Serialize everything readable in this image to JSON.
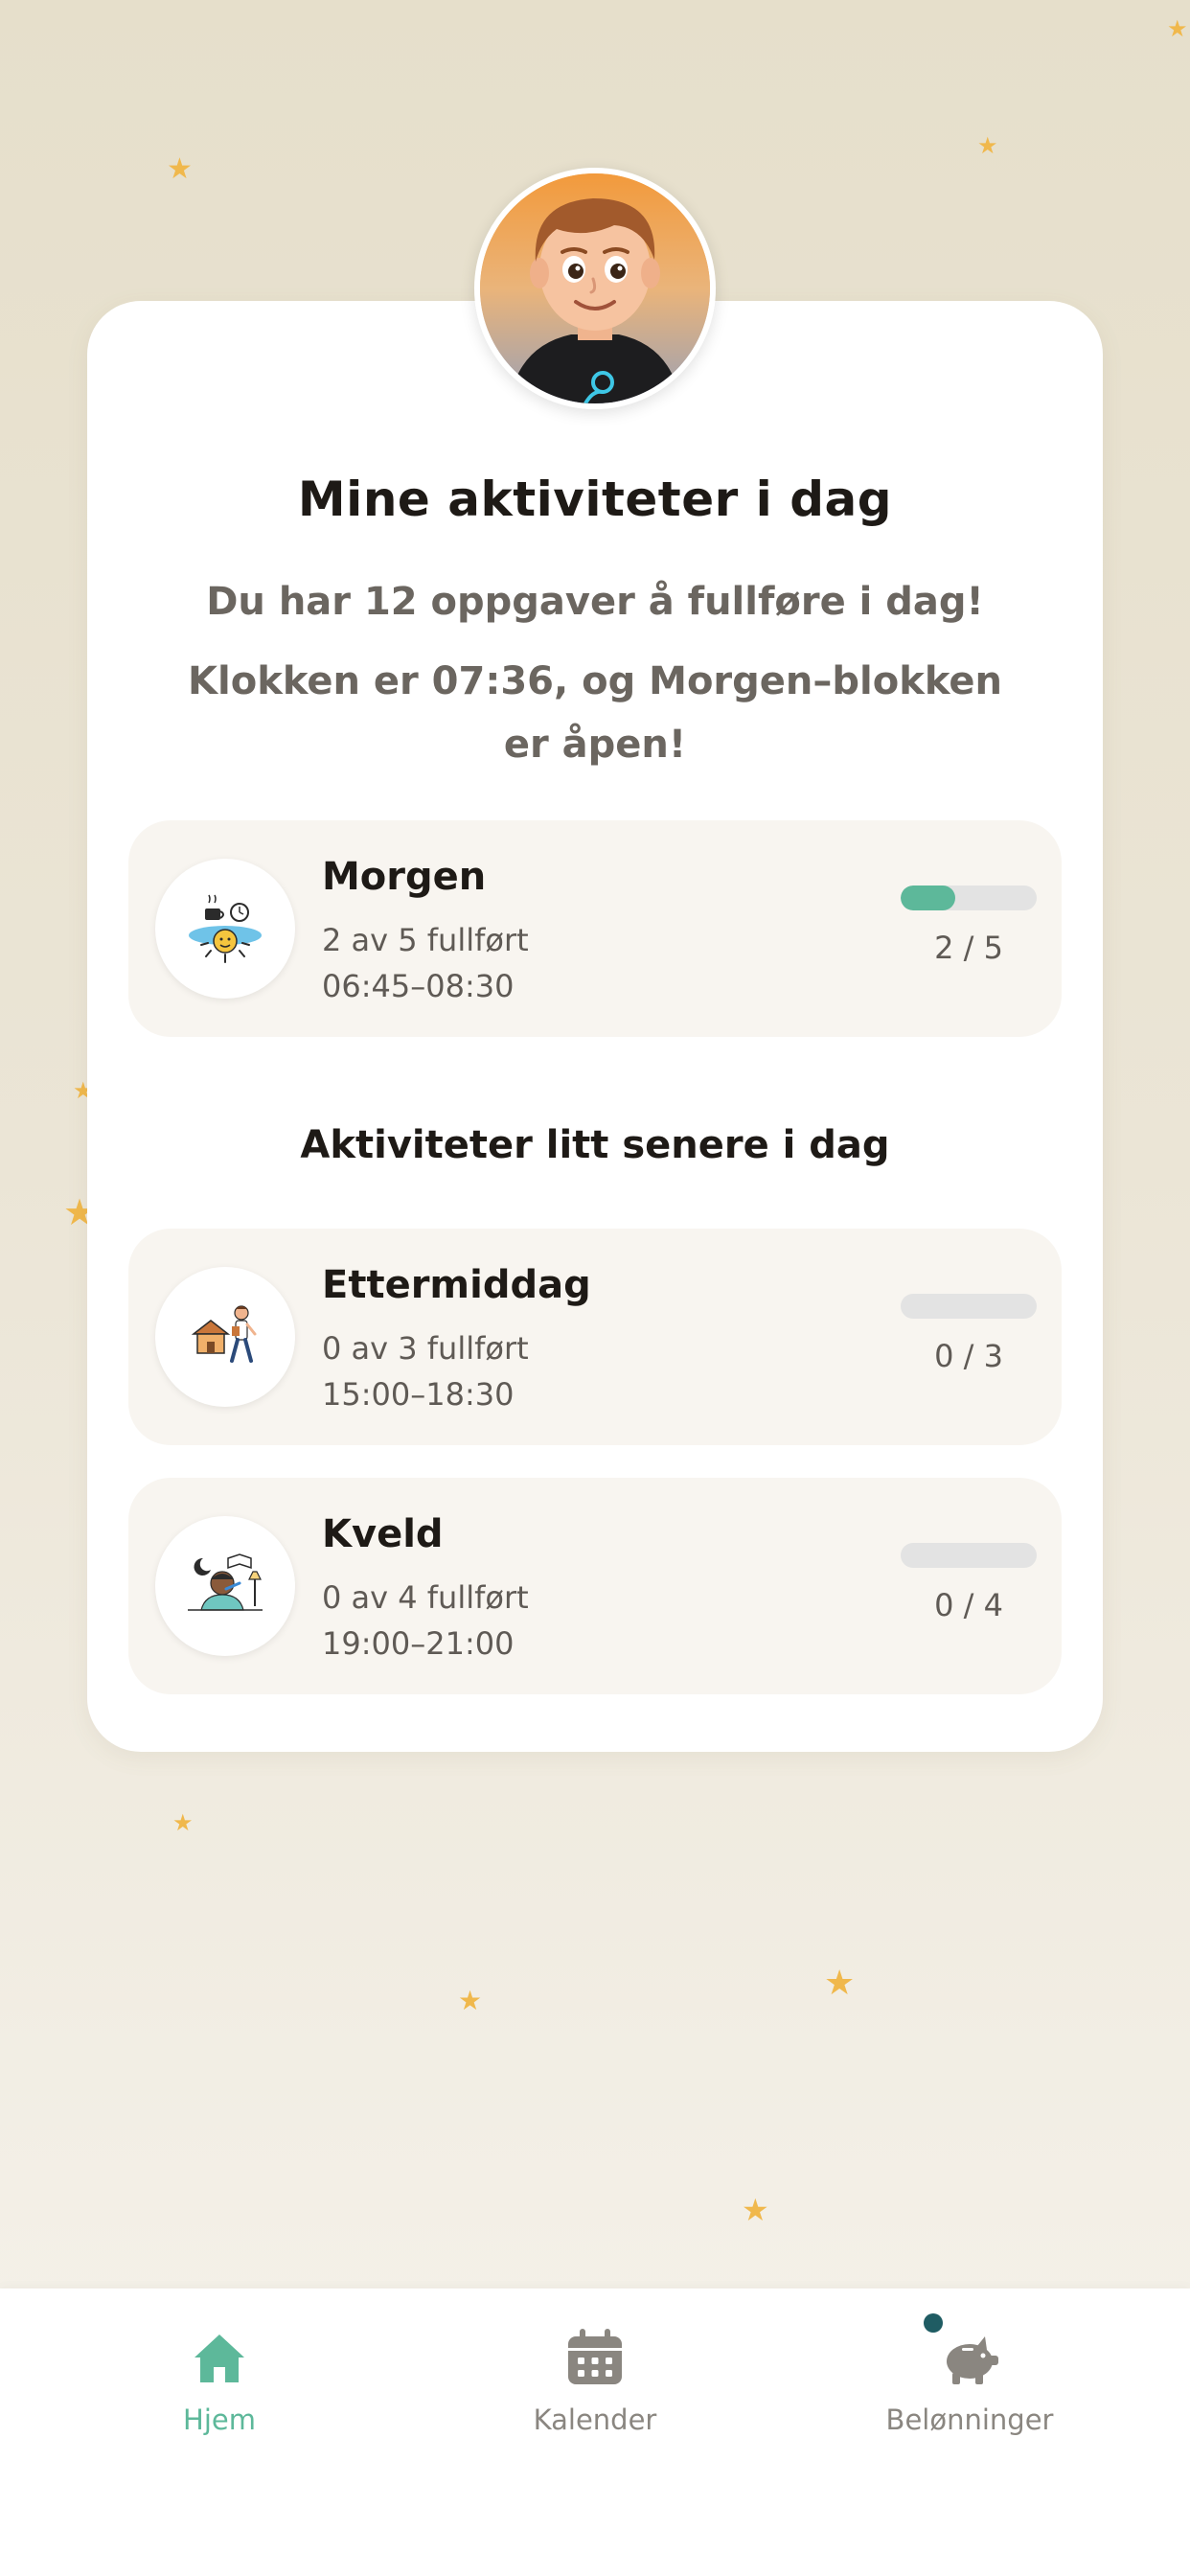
{
  "colors": {
    "accent": "#5db89a",
    "star": "#f0b84c",
    "muted_text": "#6b6660",
    "nav_inactive": "#8a8680",
    "badge": "#1f5c63"
  },
  "profile": {
    "avatar_icon": "child-avatar"
  },
  "page": {
    "title": "Mine aktiviteter i dag",
    "subtitle": "Du har 12 oppgaver å fullføre i dag!",
    "status": "Klokken er 07:36, og Morgen–blokken er åpen!"
  },
  "current_block": {
    "name": "Morgen",
    "count_text": "2 av 5 fullført",
    "time": "06:45–08:30",
    "ratio": "2 / 5",
    "completed": 2,
    "total": 5,
    "icon": "morning-sun-icon"
  },
  "later": {
    "heading": "Aktiviteter litt senere i dag",
    "blocks": [
      {
        "name": "Ettermiddag",
        "count_text": "0 av 3 fullført",
        "time": "15:00–18:30",
        "ratio": "0 / 3",
        "completed": 0,
        "total": 3,
        "icon": "afternoon-walk-icon"
      },
      {
        "name": "Kveld",
        "count_text": "0 av 4 fullført",
        "time": "19:00–21:00",
        "ratio": "0 / 4",
        "completed": 0,
        "total": 4,
        "icon": "evening-toothbrush-icon"
      }
    ]
  },
  "nav": {
    "items": [
      {
        "label": "Hjem",
        "icon": "home-icon",
        "active": true
      },
      {
        "label": "Kalender",
        "icon": "calendar-icon",
        "active": false
      },
      {
        "label": "Belønninger",
        "icon": "piggy-bank-icon",
        "active": false
      }
    ]
  }
}
